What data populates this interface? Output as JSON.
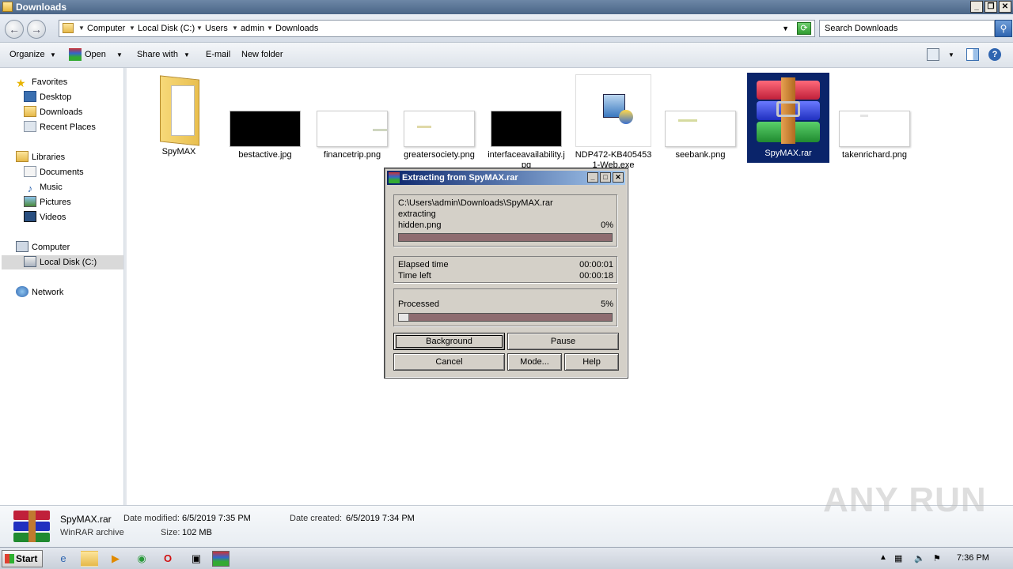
{
  "window": {
    "title": "Downloads"
  },
  "address": {
    "crumbs": [
      "Computer",
      "Local Disk (C:)",
      "Users",
      "admin",
      "Downloads"
    ],
    "search_placeholder": "Search Downloads"
  },
  "toolbar": {
    "organize": "Organize",
    "open": "Open",
    "share_with": "Share with",
    "email": "E-mail",
    "new_folder": "New folder"
  },
  "nav": {
    "favorites": "Favorites",
    "desktop": "Desktop",
    "downloads": "Downloads",
    "recent_places": "Recent Places",
    "libraries": "Libraries",
    "documents": "Documents",
    "music": "Music",
    "pictures": "Pictures",
    "videos": "Videos",
    "computer": "Computer",
    "local_disk": "Local Disk (C:)",
    "network": "Network"
  },
  "files": [
    {
      "name": "SpyMAX",
      "kind": "folder"
    },
    {
      "name": "bestactive.jpg",
      "kind": "dark"
    },
    {
      "name": "financetrip.png",
      "kind": "light"
    },
    {
      "name": "greatersociety.png",
      "kind": "light"
    },
    {
      "name": "interfaceavailability.jpg",
      "kind": "dark"
    },
    {
      "name": "NDP472-KB4054531-Web.exe",
      "kind": "exe"
    },
    {
      "name": "seebank.png",
      "kind": "light"
    },
    {
      "name": "SpyMAX.rar",
      "kind": "rar",
      "selected": true
    },
    {
      "name": "takenrichard.png",
      "kind": "light"
    }
  ],
  "dialog": {
    "title": "Extracting from SpyMAX.rar",
    "archive_path": "C:\\Users\\admin\\Downloads\\SpyMAX.rar",
    "action": "extracting",
    "current_file": "hidden.png",
    "file_percent": "0%",
    "file_progress": 0,
    "elapsed_label": "Elapsed time",
    "elapsed_value": "00:00:01",
    "time_left_label": "Time left",
    "time_left_value": "00:00:18",
    "processed_label": "Processed",
    "processed_percent": "5%",
    "processed_progress": 0.05,
    "buttons": {
      "background": "Background",
      "pause": "Pause",
      "cancel": "Cancel",
      "mode": "Mode...",
      "help": "Help"
    }
  },
  "details": {
    "name": "SpyMAX.rar",
    "type": "WinRAR archive",
    "date_modified_label": "Date modified:",
    "date_modified": "6/5/2019 7:35 PM",
    "size_label": "Size:",
    "size": "102 MB",
    "date_created_label": "Date created:",
    "date_created": "6/5/2019 7:34 PM"
  },
  "taskbar": {
    "start": "Start",
    "clock": "7:36 PM"
  },
  "watermark": "ANY RUN"
}
